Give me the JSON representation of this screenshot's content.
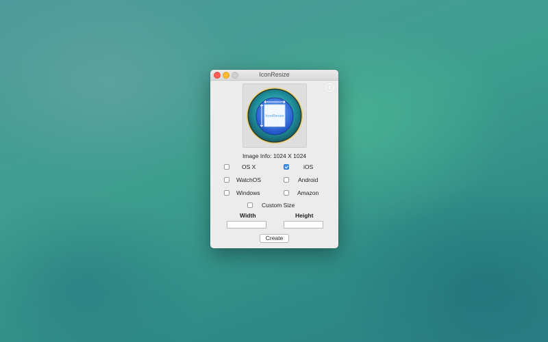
{
  "window": {
    "title": "IconResize"
  },
  "preview": {
    "badge_text": "IconResize"
  },
  "image_info": "Image Info: 1024 X 1024",
  "platforms": [
    {
      "label": "OS X",
      "checked": false
    },
    {
      "label": "iOS",
      "checked": true
    },
    {
      "label": "WatchOS",
      "checked": false
    },
    {
      "label": "Android",
      "checked": false
    },
    {
      "label": "Windows",
      "checked": false
    },
    {
      "label": "Amazon",
      "checked": false
    }
  ],
  "custom_size": {
    "label": "Custom Size",
    "checked": false
  },
  "width_label": "Width",
  "height_label": "Height",
  "width_value": "",
  "height_value": "",
  "create_label": "Create",
  "colors": {
    "checkbox_accent": "#3b8fe8",
    "close": "#fc5f57",
    "minimize": "#fdbc2e"
  }
}
